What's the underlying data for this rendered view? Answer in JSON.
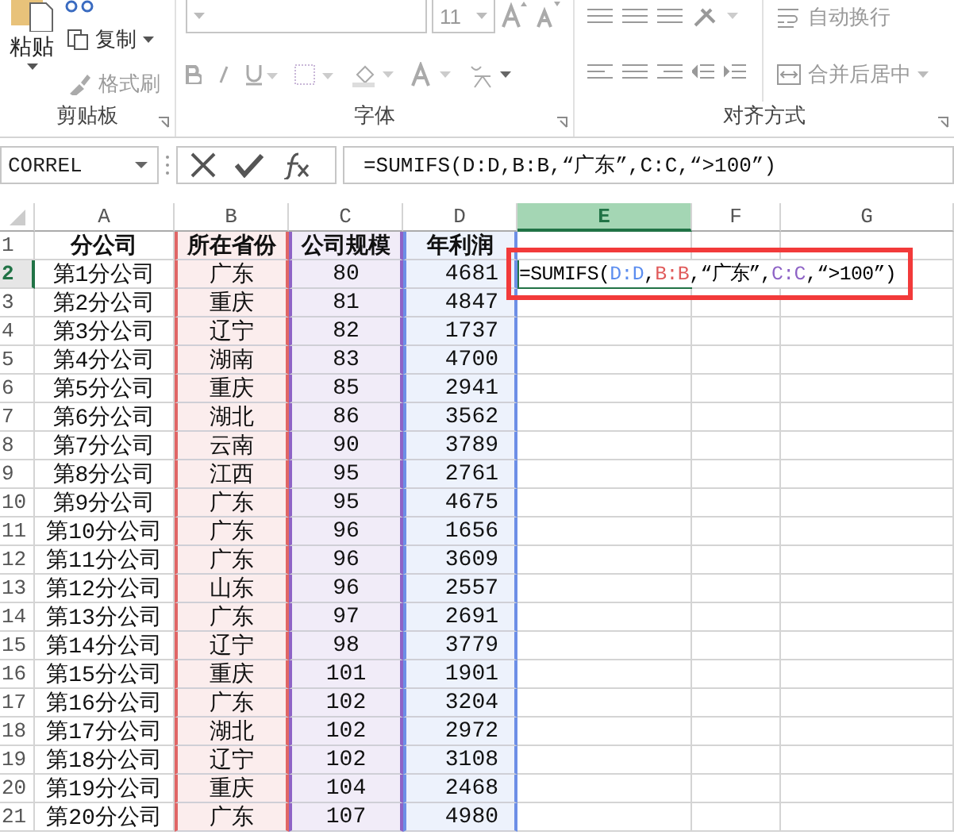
{
  "ribbon": {
    "clipboard": {
      "paste": {
        "label": "粘贴"
      },
      "items": [
        {
          "label": "复制",
          "disabled": false,
          "kind": "copy"
        },
        {
          "label": "格式刷",
          "disabled": true,
          "kind": "brush"
        }
      ],
      "group_label": "剪贴板"
    },
    "font": {
      "size": "11",
      "group_label": "字体"
    },
    "alignment": {
      "items": [
        {
          "label": "自动换行",
          "disabled": true,
          "kind": "wrap"
        },
        {
          "label": "合并后居中",
          "disabled": true,
          "kind": "merge"
        }
      ],
      "group_label": "对齐方式"
    }
  },
  "formula_bar": {
    "name_box": "CORREL",
    "formula": "=SUMIFS(D:D,B:B,“广东”,C:C,“>100”)"
  },
  "sheet": {
    "columns": [
      {
        "letter": "A",
        "selected": false
      },
      {
        "letter": "B",
        "selected": false,
        "color": "#e06666"
      },
      {
        "letter": "C",
        "selected": false,
        "color": "#8e63c6"
      },
      {
        "letter": "D",
        "selected": false,
        "color": "#6d8fe6"
      },
      {
        "letter": "E",
        "selected": true
      },
      {
        "letter": "F",
        "selected": false
      },
      {
        "letter": "G",
        "selected": false
      }
    ],
    "rows": [
      {
        "number": "1",
        "selected": false,
        "header": true,
        "cells": [
          "分公司",
          "所在省份",
          "公司规模",
          "年利润"
        ]
      },
      {
        "number": "2",
        "selected": true,
        "cells": [
          "第1分公司",
          "广东",
          "80",
          "4681"
        ],
        "formula": [
          {
            "text": "=SUMIFS(",
            "color": "#000000"
          },
          {
            "text": "D:D",
            "color": "#5b8def"
          },
          {
            "text": ",",
            "color": "#000000"
          },
          {
            "text": "B:B",
            "color": "#e05a5a"
          },
          {
            "text": ",“广东”,",
            "color": "#000000"
          },
          {
            "text": "C:C",
            "color": "#8e63c6"
          },
          {
            "text": ",“>100”)",
            "color": "#000000"
          }
        ]
      },
      {
        "number": "3",
        "selected": false,
        "cells": [
          "第2分公司",
          "重庆",
          "81",
          "4847"
        ]
      },
      {
        "number": "4",
        "selected": false,
        "cells": [
          "第3分公司",
          "辽宁",
          "82",
          "1737"
        ]
      },
      {
        "number": "5",
        "selected": false,
        "cells": [
          "第4分公司",
          "湖南",
          "83",
          "4700"
        ]
      },
      {
        "number": "6",
        "selected": false,
        "cells": [
          "第5分公司",
          "重庆",
          "85",
          "2941"
        ]
      },
      {
        "number": "7",
        "selected": false,
        "cells": [
          "第6分公司",
          "湖北",
          "86",
          "3562"
        ]
      },
      {
        "number": "8",
        "selected": false,
        "cells": [
          "第7分公司",
          "云南",
          "90",
          "3789"
        ]
      },
      {
        "number": "9",
        "selected": false,
        "cells": [
          "第8分公司",
          "江西",
          "95",
          "2761"
        ]
      },
      {
        "number": "10",
        "selected": false,
        "cells": [
          "第9分公司",
          "广东",
          "95",
          "4675"
        ]
      },
      {
        "number": "11",
        "selected": false,
        "cells": [
          "第10分公司",
          "广东",
          "96",
          "1656"
        ]
      },
      {
        "number": "12",
        "selected": false,
        "cells": [
          "第11分公司",
          "广东",
          "96",
          "3609"
        ]
      },
      {
        "number": "13",
        "selected": false,
        "cells": [
          "第12分公司",
          "山东",
          "96",
          "2557"
        ]
      },
      {
        "number": "14",
        "selected": false,
        "cells": [
          "第13分公司",
          "广东",
          "97",
          "2691"
        ]
      },
      {
        "number": "15",
        "selected": false,
        "cells": [
          "第14分公司",
          "辽宁",
          "98",
          "3779"
        ]
      },
      {
        "number": "16",
        "selected": false,
        "cells": [
          "第15分公司",
          "重庆",
          "101",
          "1901"
        ]
      },
      {
        "number": "17",
        "selected": false,
        "cells": [
          "第16分公司",
          "广东",
          "102",
          "3204"
        ]
      },
      {
        "number": "18",
        "selected": false,
        "cells": [
          "第17分公司",
          "湖北",
          "102",
          "2972"
        ]
      },
      {
        "number": "19",
        "selected": false,
        "cells": [
          "第18分公司",
          "辽宁",
          "102",
          "3108"
        ]
      },
      {
        "number": "20",
        "selected": false,
        "cells": [
          "第19分公司",
          "重庆",
          "104",
          "2468"
        ]
      },
      {
        "number": "21",
        "selected": false,
        "cells": [
          "第20分公司",
          "广东",
          "107",
          "4980"
        ]
      }
    ]
  }
}
